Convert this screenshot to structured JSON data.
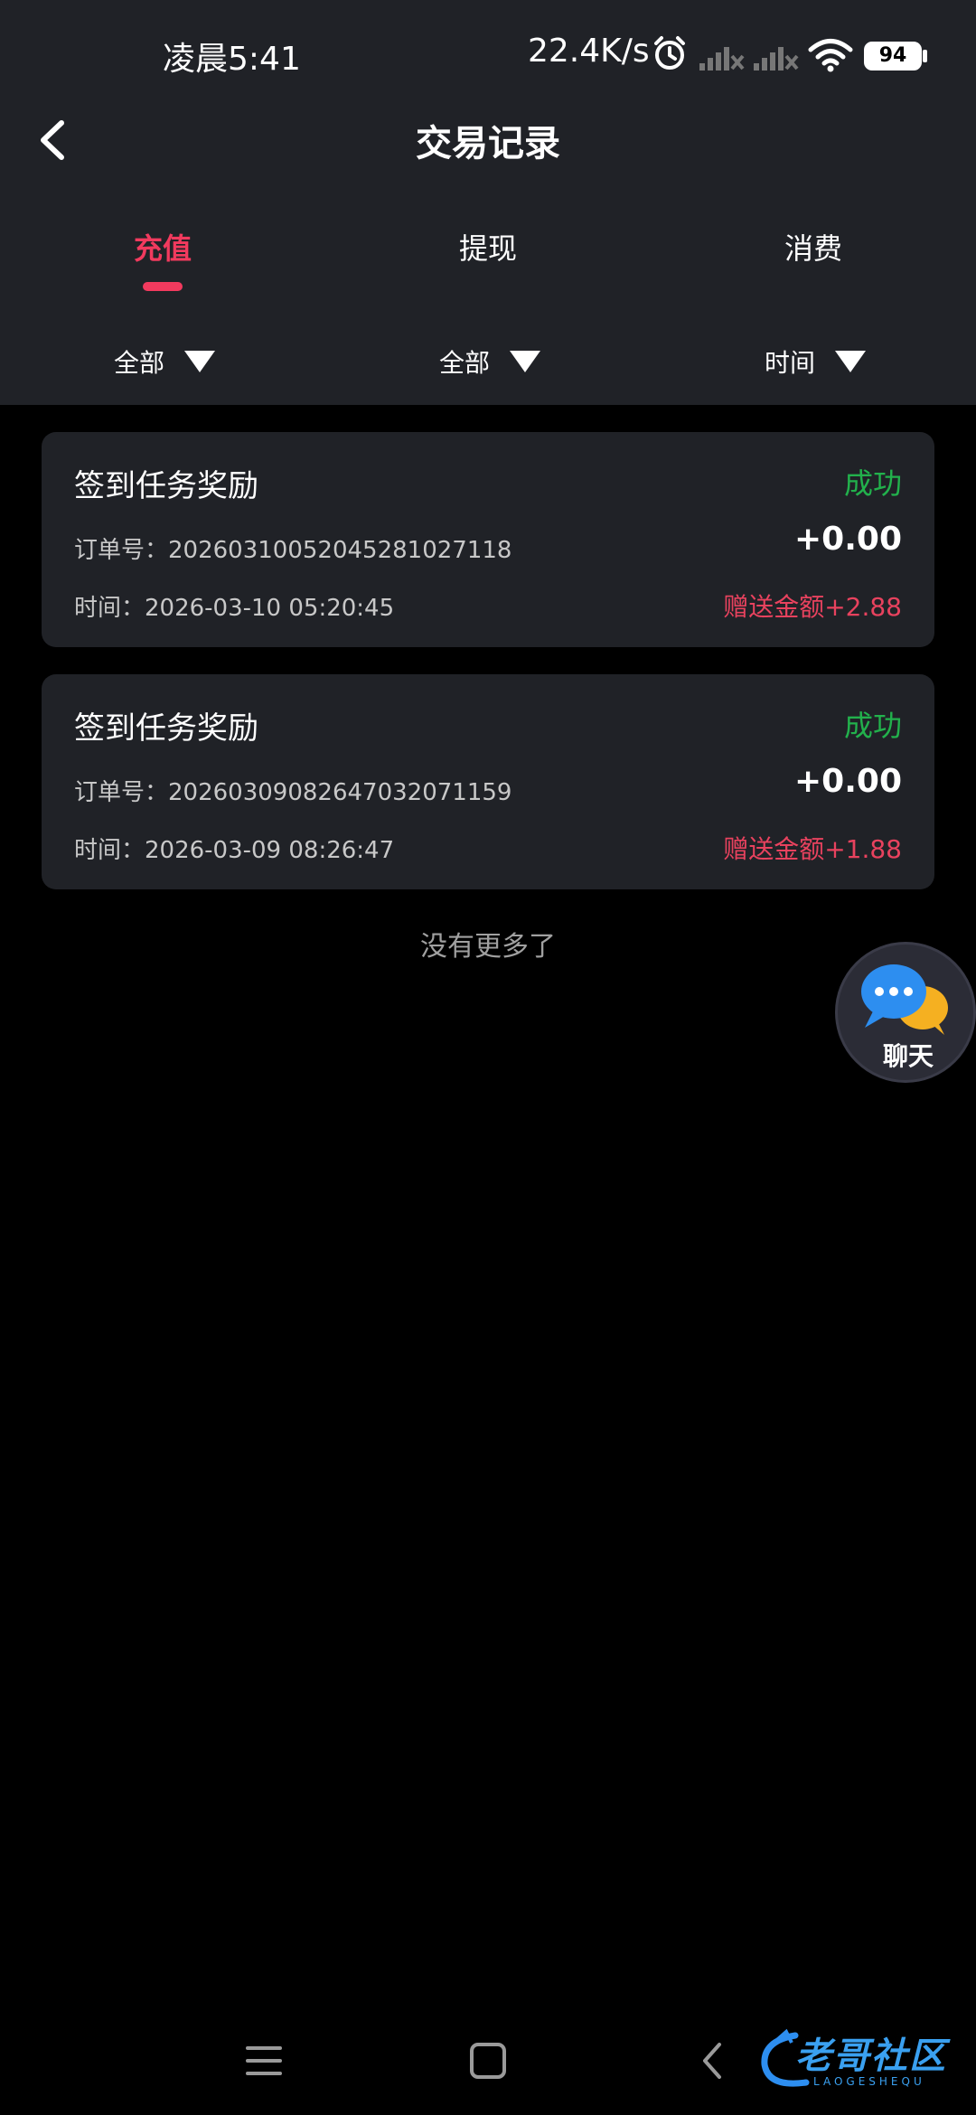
{
  "status_bar": {
    "time": "凌晨5:41",
    "net_speed": "22.4K/s",
    "battery": "94"
  },
  "header": {
    "title": "交易记录"
  },
  "tabs": [
    {
      "label": "充值",
      "active": true
    },
    {
      "label": "提现",
      "active": false
    },
    {
      "label": "消费",
      "active": false
    }
  ],
  "filters": [
    {
      "label": "全部"
    },
    {
      "label": "全部"
    },
    {
      "label": "时间"
    }
  ],
  "records": [
    {
      "title": "签到任务奖励",
      "status": "成功",
      "order": "订单号：20260310052045281027118",
      "amount": "+0.00",
      "time": "时间：2026-03-10 05:20:45",
      "bonus": "赠送金额+2.88"
    },
    {
      "title": "签到任务奖励",
      "status": "成功",
      "order": "订单号：20260309082647032071159",
      "amount": "+0.00",
      "time": "时间：2026-03-09 08:26:47",
      "bonus": "赠送金额+1.88"
    }
  ],
  "list_end": "没有更多了",
  "chat_fab": {
    "label": "聊天"
  },
  "watermark": {
    "text": "老哥社区",
    "sub": "LAOGESHEQU"
  },
  "colors": {
    "accent": "#f23a5e",
    "success": "#22b14c",
    "bonus": "#e8425e",
    "panel": "#202227",
    "background": "#000000"
  }
}
